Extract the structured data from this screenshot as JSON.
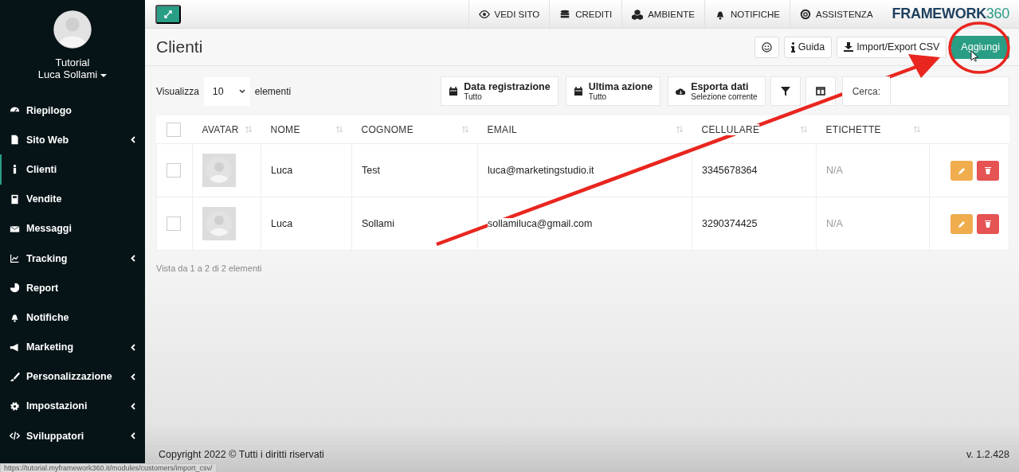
{
  "sidebar": {
    "account": "Tutorial",
    "user": "Luca Sollami",
    "items": [
      {
        "label": "Riepilogo",
        "has_submenu": false,
        "selected": false
      },
      {
        "label": "Sito Web",
        "has_submenu": true,
        "selected": false
      },
      {
        "label": "Clienti",
        "has_submenu": false,
        "selected": true
      },
      {
        "label": "Vendite",
        "has_submenu": false,
        "selected": false
      },
      {
        "label": "Messaggi",
        "has_submenu": false,
        "selected": false
      },
      {
        "label": "Tracking",
        "has_submenu": true,
        "selected": false
      },
      {
        "label": "Report",
        "has_submenu": false,
        "selected": false
      },
      {
        "label": "Notifiche",
        "has_submenu": false,
        "selected": false
      },
      {
        "label": "Marketing",
        "has_submenu": true,
        "selected": false
      },
      {
        "label": "Personalizzazione",
        "has_submenu": true,
        "selected": false
      },
      {
        "label": "Impostazioni",
        "has_submenu": true,
        "selected": false
      },
      {
        "label": "Sviluppatori",
        "has_submenu": true,
        "selected": false
      }
    ]
  },
  "topbar": {
    "links": [
      "VEDI SITO",
      "CREDITI",
      "AMBIENTE",
      "NOTIFICHE",
      "ASSISTENZA"
    ],
    "logo_text": "FRAMEWORK",
    "logo_number": "360"
  },
  "page": {
    "title": "Clienti",
    "actions": [
      {
        "kind": "icon"
      },
      {
        "kind": "plain",
        "label": "Guida"
      },
      {
        "kind": "plain",
        "label": "Import/Export CSV"
      },
      {
        "kind": "primary",
        "label": "Aggiungi"
      }
    ]
  },
  "toolbar": {
    "show_label": "Visualizza",
    "page_size": "10",
    "show_suffix": "elementi",
    "filters": [
      {
        "title": "Data registrazione",
        "subtitle": "Tutto"
      },
      {
        "title": "Ultima azione",
        "subtitle": "Tutto"
      },
      {
        "title": "Esporta dati",
        "subtitle": "Selezione corrente"
      }
    ],
    "search_label": "Cerca:"
  },
  "table": {
    "all_checked": false,
    "columns": [
      "AVATAR",
      "NOME",
      "COGNOME",
      "EMAIL",
      "CELLULARE",
      "ETICHETTE"
    ],
    "rows": [
      {
        "checked": false,
        "nome": "Luca",
        "cognome": "Test",
        "email": "luca@marketingstudio.it",
        "cellulare": "3345678364",
        "etichette": "N/A"
      },
      {
        "checked": false,
        "nome": "Luca",
        "cognome": "Sollami",
        "email": "sollamiluca@gmail.com",
        "cellulare": "3290374425",
        "etichette": "N/A"
      }
    ],
    "info": "Vista da 1 a 2 di 2 elementi"
  },
  "footer": {
    "copyright": "Copyright 2022 © Tutti i diritti riservati",
    "version": "v. 1.2.428"
  },
  "status_url": "https://tutorial.myframework360.it/modules/customers/import_csv/"
}
